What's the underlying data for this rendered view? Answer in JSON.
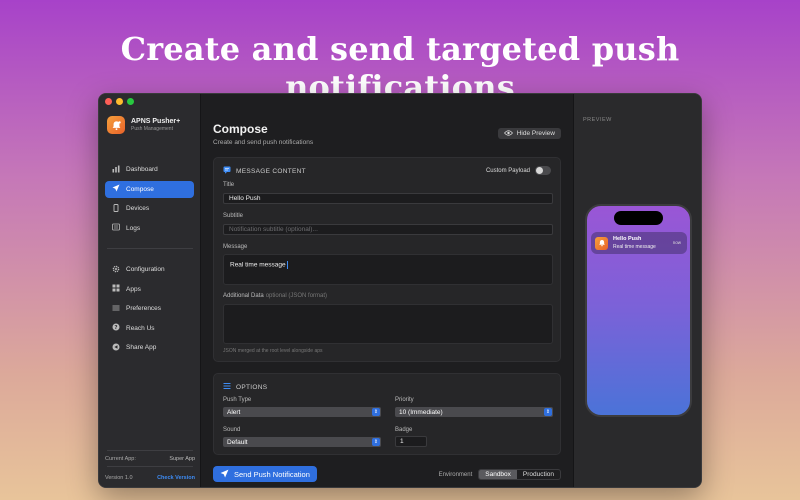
{
  "headline": "Create and send targeted push notifications",
  "app": {
    "name": "APNS Pusher+",
    "subtitle": "Push Management"
  },
  "nav_primary": [
    {
      "label": "Dashboard",
      "icon": "chart-bar-icon",
      "active": false
    },
    {
      "label": "Compose",
      "icon": "paper-plane-icon",
      "active": true
    },
    {
      "label": "Devices",
      "icon": "phone-icon",
      "active": false
    },
    {
      "label": "Logs",
      "icon": "list-icon",
      "active": false
    }
  ],
  "nav_secondary": [
    {
      "label": "Configuration",
      "icon": "gear-icon"
    },
    {
      "label": "Apps",
      "icon": "grid-icon"
    },
    {
      "label": "Preferences",
      "icon": "sliders-icon"
    },
    {
      "label": "Reach Us",
      "icon": "question-icon"
    },
    {
      "label": "Share App",
      "icon": "share-icon"
    }
  ],
  "sidebar_footer": {
    "current_app_label": "Current App:",
    "current_app_value": "Super App",
    "version": "Version 1.0",
    "check_version": "Check Version"
  },
  "page": {
    "title": "Compose",
    "subtitle": "Create and send push notifications",
    "hide_preview": "Hide Preview"
  },
  "message_card": {
    "title": "MESSAGE CONTENT",
    "custom_payload_label": "Custom Payload",
    "custom_payload_on": false,
    "title_label": "Title",
    "title_value": "Hello Push",
    "subtitle_label": "Subtitle",
    "subtitle_placeholder": "Notification subtitle (optional)...",
    "message_label": "Message",
    "message_value": "Real time message",
    "additional_label": "Additional Data",
    "additional_hint": "optional (JSON format)",
    "additional_helper": "JSON merged at the root level alongside aps"
  },
  "options_card": {
    "title": "OPTIONS",
    "push_type_label": "Push Type",
    "push_type_value": "Alert",
    "priority_label": "Priority",
    "priority_value": "10 (Immediate)",
    "sound_label": "Sound",
    "sound_value": "Default",
    "badge_label": "Badge",
    "badge_value": "1"
  },
  "footer": {
    "send_label": "Send Push Notification",
    "environment_label": "Environment",
    "env_options": [
      "Sandbox",
      "Production"
    ],
    "env_selected": "Sandbox"
  },
  "preview": {
    "label": "PREVIEW",
    "notif_title": "Hello Push",
    "notif_body": "Real time message",
    "notif_time": "now"
  },
  "colors": {
    "accent": "#2f6fdf",
    "app_icon": "#f08a34"
  }
}
